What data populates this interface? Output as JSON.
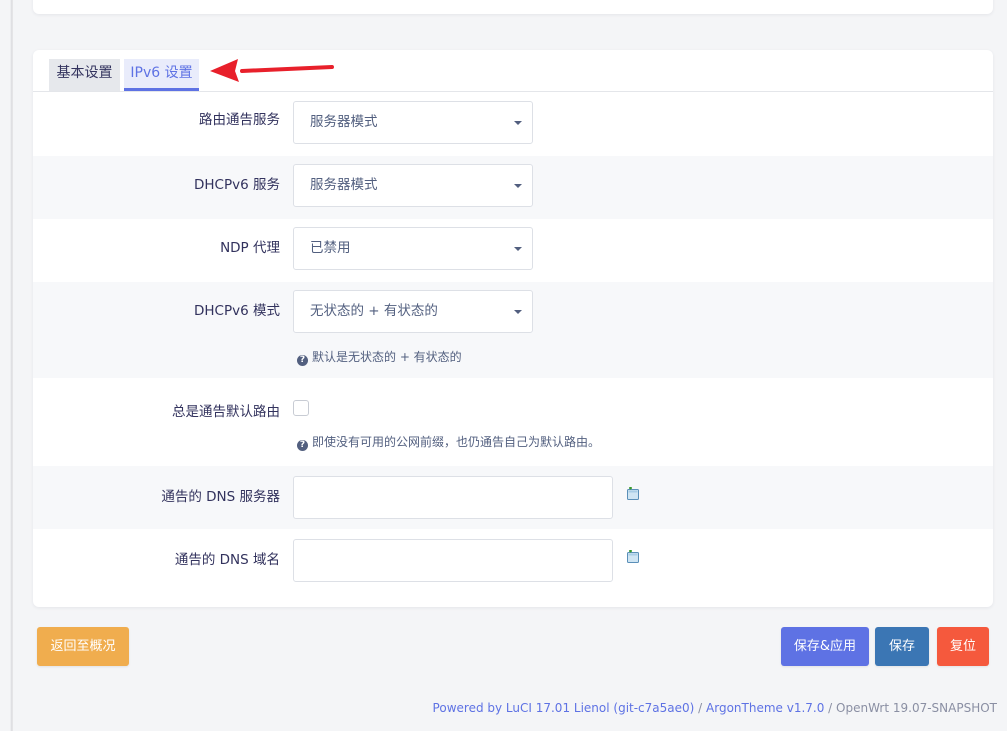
{
  "tabs": [
    {
      "label": "基本设置"
    },
    {
      "label": "IPv6 设置"
    }
  ],
  "fields": {
    "ra": {
      "label": "路由通告服务",
      "value": "服务器模式"
    },
    "dhcpv6": {
      "label": "DHCPv6 服务",
      "value": "服务器模式"
    },
    "ndp": {
      "label": "NDP 代理",
      "value": "已禁用"
    },
    "dhcpv6_mode": {
      "label": "DHCPv6 模式",
      "value": "无状态的 + 有状态的",
      "help": "默认是无状态的 + 有状态的"
    },
    "ra_default": {
      "label": "总是通告默认路由",
      "checked": false,
      "help": "即使没有可用的公网前缀，也仍通告自己为默认路由。"
    },
    "dns_servers": {
      "label": "通告的 DNS 服务器",
      "value": ""
    },
    "dns_domains": {
      "label": "通告的 DNS 域名",
      "value": ""
    }
  },
  "icons": {
    "help": "?",
    "add": "add-icon",
    "arrow": "arrow-icon"
  },
  "buttons": {
    "back": "返回至概况",
    "save_apply": "保存&应用",
    "save": "保存",
    "reset": "复位"
  },
  "footer": {
    "powered": "Powered by LuCI 17.01 Lienol (git-c7a5ae0)",
    "sep1": " / ",
    "theme": "ArgonTheme v1.7.0",
    "sep2": " / ",
    "os": "OpenWrt 19.07-SNAPSHOT"
  },
  "colors": {
    "accent": "#5e72e4",
    "warning": "#f0ad4e",
    "save": "#3b76b4",
    "danger": "#f5593d",
    "annotation_arrow": "#e8202b"
  }
}
